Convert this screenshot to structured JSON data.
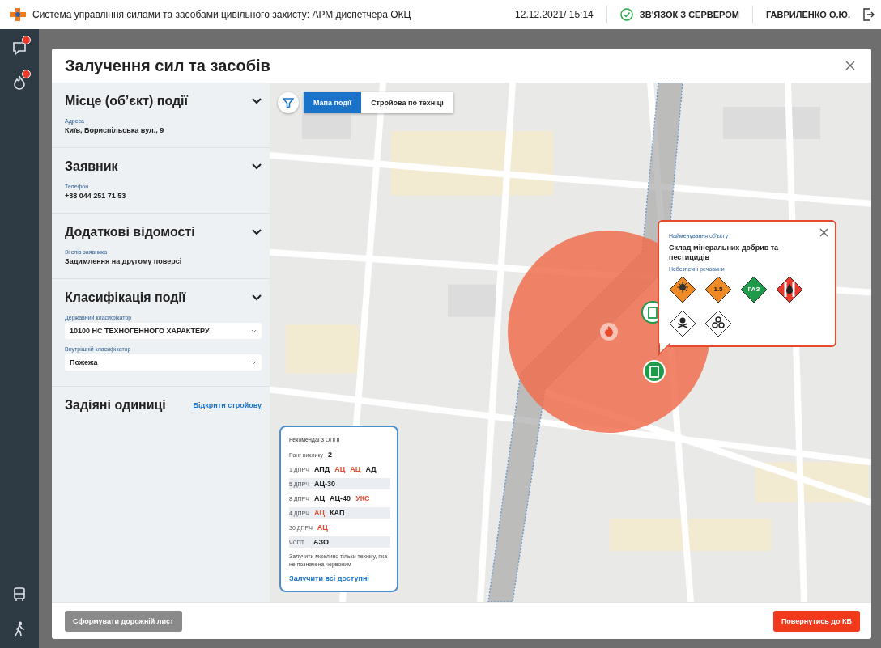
{
  "app": {
    "title": "Система управління силами та засобами цивільного захисту: АРМ диспетчера ОКЦ",
    "datetime": "12.12.2021/ 15:14",
    "connection": "ЗВ'ЯЗОК З СЕРВЕРОМ",
    "user": "ГАВРИЛЕНКО О.Ю."
  },
  "sidebar": {
    "items": [
      {
        "kind": "chat",
        "badge": true
      },
      {
        "kind": "fire",
        "badge": true
      },
      {
        "kind": "bus",
        "badge": false
      },
      {
        "kind": "walk",
        "badge": false
      }
    ]
  },
  "dialog": {
    "title": "Залучення сил та засобів",
    "sections": [
      {
        "title": "Місце (об’єкт) події",
        "expanded": true,
        "fields": [
          {
            "kind": "text",
            "label": "Адреса",
            "value": "Київ, Бориспільська вул., 9"
          }
        ]
      },
      {
        "title": "Заявник",
        "expanded": true,
        "fields": [
          {
            "kind": "text",
            "label": "Телефон",
            "value": "+38 044 251 71 53"
          }
        ]
      },
      {
        "title": "Додаткові відомості",
        "expanded": true,
        "fields": [
          {
            "kind": "text",
            "label": "Зі слів заявника",
            "value": "Задимлення на другому поверсі"
          }
        ]
      },
      {
        "title": "Класифікація події",
        "expanded": true,
        "fields": [
          {
            "kind": "select",
            "label": "Державний класифікатор",
            "value": "10100 НС ТЕХНОГЕННОГО ХАРАКТЕРУ"
          },
          {
            "kind": "select",
            "label": "Внутрішній класифікатор",
            "value": "Пожежа"
          }
        ]
      },
      {
        "title": "Задіяні одиниці",
        "link": "Відкрити стройову"
      }
    ],
    "map": {
      "tabs": [
        {
          "label": "Мапа події",
          "selected": true
        },
        {
          "label": "Стройова по техніці",
          "selected": false
        }
      ],
      "popup": {
        "name_label": "Найменування об’єкту",
        "name": "Склад мінеральних добрив та пестицидів",
        "hazards_label": "Небезпечні речовини",
        "hazards": [
          {
            "kind": "explosive",
            "color": "#f08a24"
          },
          {
            "kind": "number",
            "text": "1.5",
            "color": "#f08a24"
          },
          {
            "kind": "number",
            "text": "ГАЗ",
            "color": "#1f9a4a"
          },
          {
            "kind": "flammable",
            "color": "#e8392b"
          },
          {
            "kind": "toxic",
            "color": "#ffffff"
          },
          {
            "kind": "biohazard",
            "color": "#ffffff"
          }
        ]
      },
      "recommendations": {
        "title": "Рекомендаї з ОППГ",
        "rank_label": "Ранг виклику",
        "rank": "2",
        "rows": [
          {
            "unit": "1 ДПРЧ",
            "vehicles": [
              {
                "name": "АПД",
                "unavailable": false
              },
              {
                "name": "АЦ",
                "unavailable": true
              },
              {
                "name": "АЦ",
                "unavailable": true
              },
              {
                "name": "АД",
                "unavailable": false
              }
            ]
          },
          {
            "unit": "5 ДПРЧ",
            "vehicles": [
              {
                "name": "АЦ-30",
                "unavailable": false
              }
            ]
          },
          {
            "unit": "8 ДПРЧ",
            "vehicles": [
              {
                "name": "АЦ",
                "unavailable": false
              },
              {
                "name": "АЦ-40",
                "unavailable": false
              },
              {
                "name": "УКС",
                "unavailable": true
              }
            ]
          },
          {
            "unit": "4 ДПРЧ",
            "vehicles": [
              {
                "name": "АЦ",
                "unavailable": true
              },
              {
                "name": "КАП",
                "unavailable": false
              }
            ]
          },
          {
            "unit": "30 ДПРЧ",
            "vehicles": [
              {
                "name": "АЦ",
                "unavailable": true
              }
            ]
          },
          {
            "unit": "ЧСПТ",
            "vehicles": [
              {
                "name": "АЗО",
                "unavailable": false
              }
            ]
          }
        ],
        "note": "Залучити можливо тільки техніку, яка не позначена червоним",
        "link": "Залучити всі доступні"
      }
    },
    "buttons": [
      {
        "label": "Сформувати дорожній лист",
        "disabled": true
      },
      {
        "label": "Повернутись до КВ",
        "disabled": false
      }
    ]
  }
}
